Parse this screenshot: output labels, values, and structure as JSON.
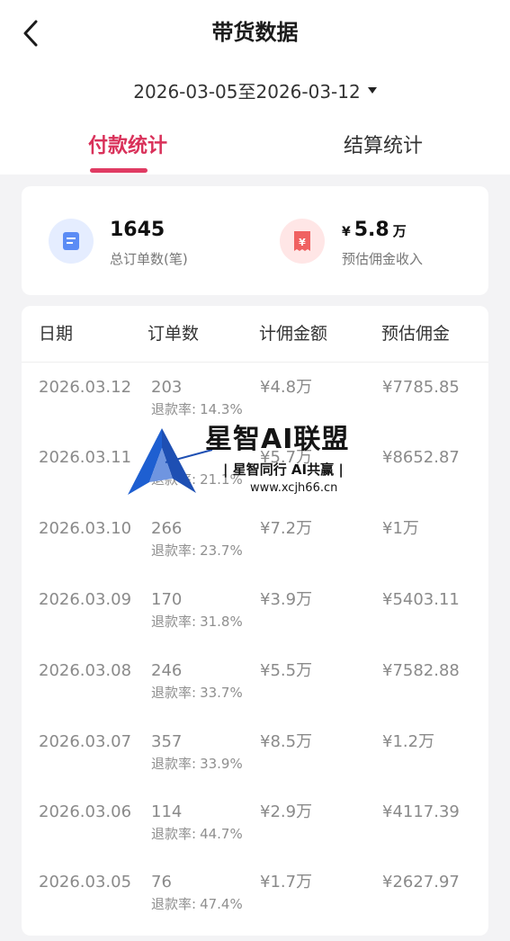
{
  "header": {
    "title": "带货数据",
    "date_range": "2026-03-05至2026-03-12"
  },
  "tabs": [
    {
      "label": "付款统计",
      "active": true
    },
    {
      "label": "结算统计",
      "active": false
    }
  ],
  "summary": {
    "orders": {
      "value": "1645",
      "label": "总订单数(笔)"
    },
    "commission": {
      "currency": "¥",
      "value": "5.8",
      "unit": "万",
      "label": "预估佣金收入"
    }
  },
  "table": {
    "headers": [
      "日期",
      "订单数",
      "计佣金额",
      "预估佣金"
    ],
    "refund_label": "退款率:",
    "rows": [
      {
        "date": "2026.03.12",
        "orders": "203",
        "refund": "14.3%",
        "amount": "¥4.8万",
        "commission": "¥7785.85"
      },
      {
        "date": "2026.03.11",
        "orders": "",
        "refund": "21.1%",
        "amount": "¥5.7万",
        "commission": "¥8652.87"
      },
      {
        "date": "2026.03.10",
        "orders": "266",
        "refund": "23.7%",
        "amount": "¥7.2万",
        "commission": "¥1万"
      },
      {
        "date": "2026.03.09",
        "orders": "170",
        "refund": "31.8%",
        "amount": "¥3.9万",
        "commission": "¥5403.11"
      },
      {
        "date": "2026.03.08",
        "orders": "246",
        "refund": "33.7%",
        "amount": "¥5.5万",
        "commission": "¥7582.88"
      },
      {
        "date": "2026.03.07",
        "orders": "357",
        "refund": "33.9%",
        "amount": "¥8.5万",
        "commission": "¥1.2万"
      },
      {
        "date": "2026.03.06",
        "orders": "114",
        "refund": "44.7%",
        "amount": "¥2.9万",
        "commission": "¥4117.39"
      },
      {
        "date": "2026.03.05",
        "orders": "76",
        "refund": "47.4%",
        "amount": "¥1.7万",
        "commission": "¥2627.97"
      }
    ]
  },
  "watermark": {
    "title": "星智AI联盟",
    "slogan": "| 星智同行 AI共赢 |",
    "url": "www.xcjh66.cn"
  },
  "colors": {
    "accent": "#e03b63",
    "order_icon": "#5b8cf5",
    "money_icon": "#f06161"
  }
}
